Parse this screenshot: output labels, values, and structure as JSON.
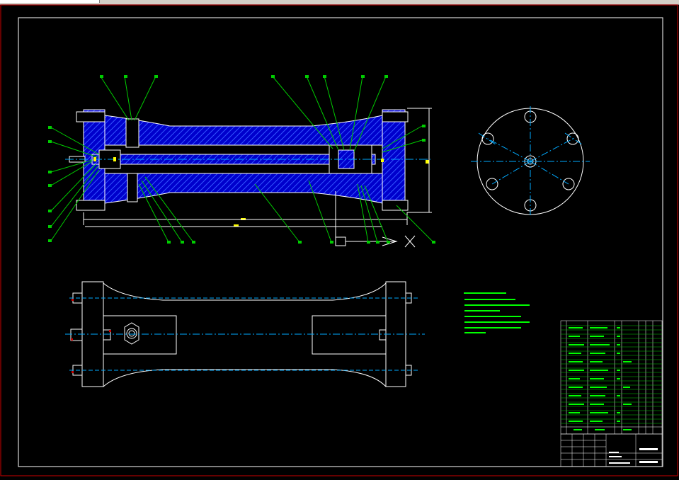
{
  "window": {
    "title": ""
  },
  "drawing": {
    "title_block": {
      "drawing_name": "",
      "drawing_number": ""
    },
    "colors": {
      "background": "#000000",
      "frame": "#ffffff",
      "outer_border": "#cc0000",
      "section_hatch": "#0000cc",
      "outline": "#ffffff",
      "leader": "#00cc00",
      "center_line": "#00aaff",
      "dimension": "#ffff00",
      "notes": "#00ff00",
      "parts_text": "#00ff00"
    }
  }
}
